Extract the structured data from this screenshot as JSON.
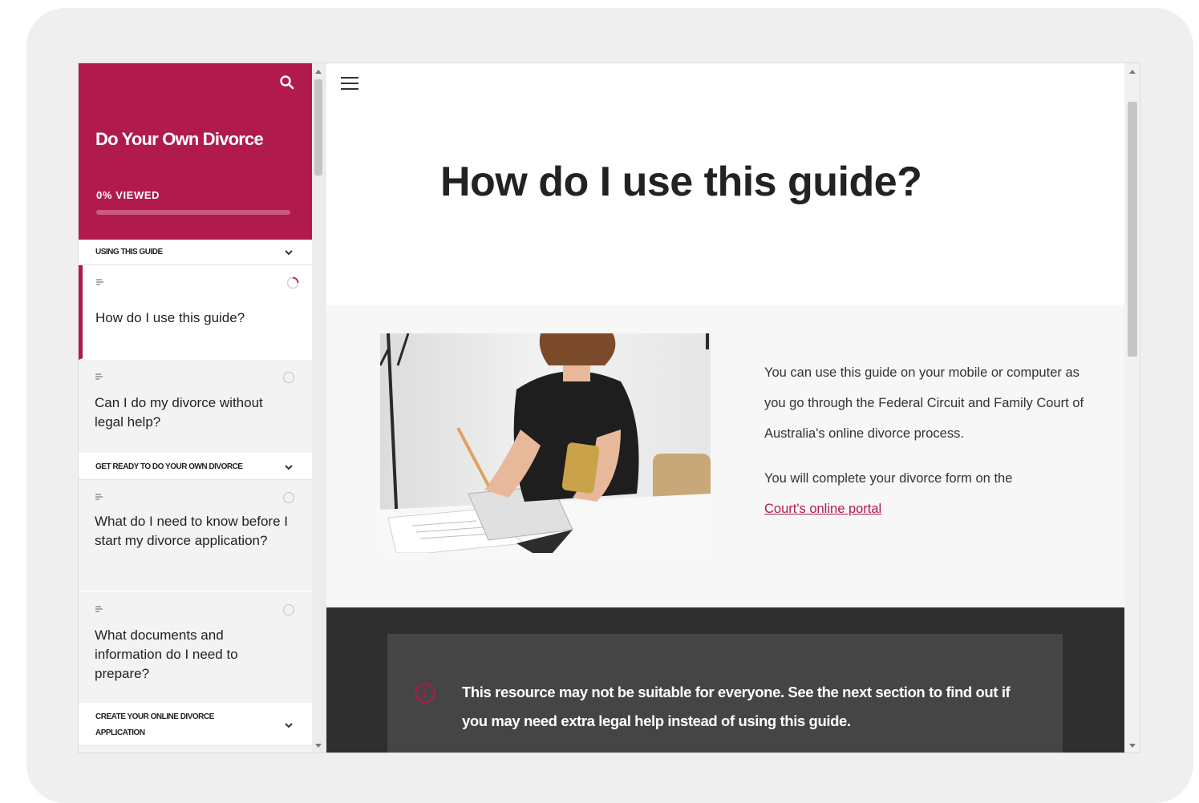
{
  "sidebar": {
    "title": "Do Your Own Divorce",
    "progress_text": "0% VIEWED",
    "progress_fraction": 0,
    "search_icon": "search-icon",
    "sections": [
      {
        "label": "USING THIS GUIDE",
        "lessons": [
          {
            "title": "How do I use this guide?",
            "status": "in-progress",
            "active": true
          },
          {
            "title": "Can I do my divorce without legal help?",
            "status": "not-started",
            "active": false
          }
        ]
      },
      {
        "label": "GET READY TO DO YOUR OWN DIVORCE",
        "lessons": [
          {
            "title": "What do I need to know before I start my divorce application?",
            "status": "not-started",
            "active": false
          },
          {
            "title": "What documents and information do I need to prepare?",
            "status": "not-started",
            "active": false
          }
        ]
      },
      {
        "label": "CREATE YOUR ONLINE DIVORCE APPLICATION",
        "lessons": []
      }
    ]
  },
  "main": {
    "menu_icon": "hamburger-menu-icon",
    "title": "How do I use this guide?",
    "intro_paragraph_1": "You can use this guide on your mobile or computer as you go through the Federal Circuit and Family Court of Australia's online divorce process.",
    "intro_paragraph_2_text": "You will complete your divorce form on the",
    "intro_link": "Court's online portal",
    "callout_text": "This resource may not be suitable for everyone. See the next section to find out if you may need extra legal help instead of using this guide.",
    "callout_icon": "info-circle-icon"
  },
  "colors": {
    "brand": "#b11a4d",
    "dark_band": "#2f2f2f",
    "callout_bg": "#454545"
  }
}
